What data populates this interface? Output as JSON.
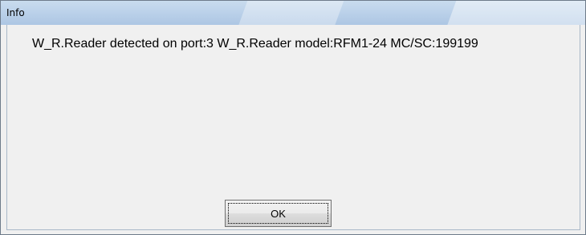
{
  "window": {
    "title": "Info"
  },
  "dialog": {
    "message": "W_R.Reader detected on port:3 W_R.Reader model:RFM1-24 MC/SC:199199"
  },
  "buttons": {
    "ok_label": "OK"
  }
}
